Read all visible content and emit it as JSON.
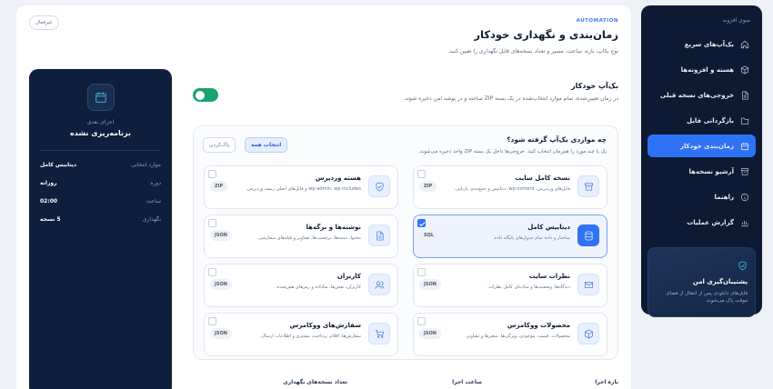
{
  "sidebar": {
    "title": "منوی افزونه",
    "items": [
      {
        "label": "بک‌آپ‌های سریع",
        "icon": "home-icon"
      },
      {
        "label": "هسته و افزونه‌ها",
        "icon": "cube-icon"
      },
      {
        "label": "خروجی‌های نسخه قبلی",
        "icon": "file-icon"
      },
      {
        "label": "بازگردانی فایل",
        "icon": "folder-icon"
      },
      {
        "label": "زمان‌بندی خودکار",
        "icon": "calendar-icon",
        "active": true
      },
      {
        "label": "آرشیو نسخه‌ها",
        "icon": "archive-icon"
      },
      {
        "label": "راهنما",
        "icon": "info-icon"
      },
      {
        "label": "گزارش عملیات",
        "icon": "chart-icon"
      }
    ],
    "card": {
      "title": "پشتیبان‌گیری امن",
      "text": "فایل‌های دانلودی پس از انتقال از فضای موقت پاک می‌شوند."
    }
  },
  "header": {
    "chip": "غیرفعال",
    "eyebrow": "AUTOMATION",
    "title": "زمان‌بندی و نگهداری خودکار",
    "subtitle": "نوع بکاپ، بازه، ساعت، مسیر و تعداد نسخه‌های قابل نگهداری را تعیین کنید."
  },
  "schedule_card": {
    "next_label": "اجرای بعدی",
    "title": "برنامه‌ریزی نشده",
    "rows": [
      {
        "key": "موارد انتخابی",
        "value": "دیتابیس کامل"
      },
      {
        "key": "دوره",
        "value": "روزانه"
      },
      {
        "key": "ساعت",
        "value": "02:00"
      },
      {
        "key": "نگهداری",
        "value": "5 نسخه"
      }
    ]
  },
  "auto_backup": {
    "title": "بک‌آپ خودکار",
    "description": "در زمان تعیین‌شده، تمام موارد انتخاب‌شده در یک بسته ZIP ساخته و در پوشه امن ذخیره شوند.",
    "enabled": true
  },
  "items_section": {
    "title": "چه مواردی بک‌آپ گرفته شود؟",
    "description": "یک یا چند مورد را هم‌زمان انتخاب کنید. خروجی‌ها داخل یک بسته ZIP واحد ذخیره می‌شوند.",
    "select_all": "انتخاب همه",
    "clear": "پاک‌کردن",
    "items": [
      {
        "title": "نسخه کامل سایت",
        "desc": "فایل‌های وردپرس، wp-content، دیتابیس و جمع‌بندی بازیابی.",
        "badge": "ZIP",
        "icon": "archive-icon",
        "selected": false
      },
      {
        "title": "هسته وردپرس",
        "desc": "wp-admin، wp-includes و فایل‌های اصلی ریشه وردپرس.",
        "badge": "ZIP",
        "icon": "shield-icon",
        "selected": false
      },
      {
        "title": "دیتابیس کامل",
        "desc": "ساختار و داده تمام جدول‌های پایگاه داده.",
        "badge": "SQL",
        "icon": "database-icon",
        "selected": true
      },
      {
        "title": "نوشته‌ها و برگه‌ها",
        "desc": "محتوا، دسته‌ها، برچسب‌ها، تصاویر و فیلدهای سفارشی.",
        "badge": "JSON",
        "icon": "document-icon",
        "selected": false
      },
      {
        "title": "نظرات سایت",
        "desc": "دیدگاه‌ها، وضعیت‌ها و متادیتای کامل نظرات.",
        "badge": "JSON",
        "icon": "mail-icon",
        "selected": false
      },
      {
        "title": "کاربران",
        "desc": "کاربران، نقش‌ها، متاداده و رمزهای هش‌شده.",
        "badge": "JSON",
        "icon": "users-icon",
        "selected": false
      },
      {
        "title": "محصولات ووکامرس",
        "desc": "محصولات، قیمت، موجودی، ویژگی‌ها، متغیرها و تصاویر.",
        "badge": "JSON",
        "icon": "box-icon",
        "selected": false
      },
      {
        "title": "سفارش‌های ووکامرس",
        "desc": "سفارش‌ها، اقلام، پرداخت، مشتری و اطلاعات ارسال.",
        "badge": "JSON",
        "icon": "cart-icon",
        "selected": false
      }
    ]
  },
  "bottom_labels": [
    "بازه اجرا",
    "ساعت اجرا",
    "تعداد نسخه‌های نگهداری"
  ]
}
